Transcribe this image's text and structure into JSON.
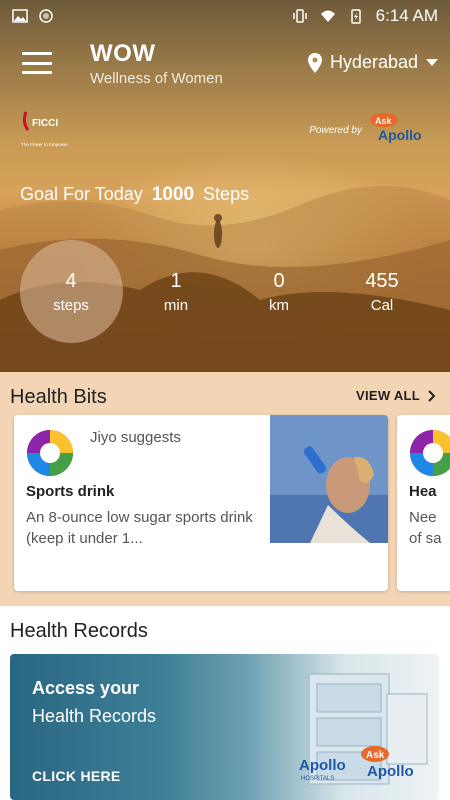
{
  "status_bar": {
    "time": "6:14 AM"
  },
  "app": {
    "title": "WOW",
    "subtitle": "Wellness of Women"
  },
  "location": {
    "city": "Hyderabad"
  },
  "branding": {
    "ficci_text": "FICCI",
    "ficci_tagline": "The Power to Empower",
    "powered_by": "Powered by",
    "ask": "Ask",
    "apollo": "Apollo"
  },
  "goal": {
    "prefix": "Goal For Today",
    "value": "1000",
    "suffix": "Steps"
  },
  "stats": [
    {
      "value": "4",
      "unit": "steps"
    },
    {
      "value": "1",
      "unit": "min"
    },
    {
      "value": "0",
      "unit": "km"
    },
    {
      "value": "455",
      "unit": "Cal"
    }
  ],
  "health_bits": {
    "title": "Health Bits",
    "view_all": "VIEW ALL",
    "cards": [
      {
        "source": "Jiyo suggests",
        "title": "Sports drink",
        "desc": "An 8-ounce low sugar sports drink (keep it under 1..."
      },
      {
        "title": "Hea",
        "desc": "Nee of sa"
      }
    ]
  },
  "health_records": {
    "title": "Health Records",
    "banner_line1": "Access your",
    "banner_line2": "Health Records",
    "cta": "CLICK HERE",
    "apollo_hospitals": "Apollo",
    "hospitals_label": "HOSPITALS",
    "ask": "Ask",
    "apollo": "Apollo"
  },
  "colors": {
    "bits_bg": "#f3d5b5",
    "banner_start": "#2a6782",
    "apollo_orange": "#e8682b",
    "apollo_blue": "#1c5aa6"
  }
}
